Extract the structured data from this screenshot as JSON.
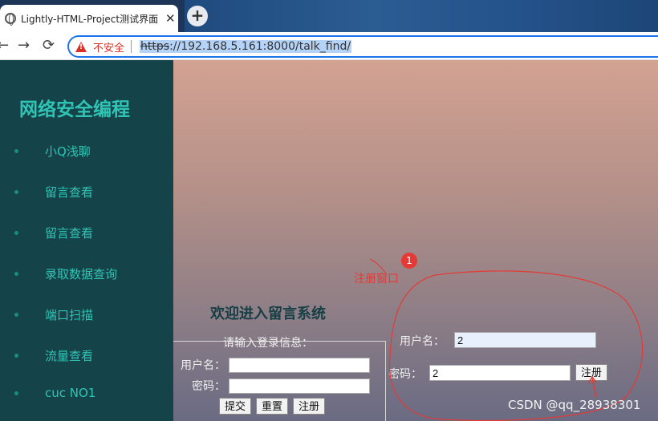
{
  "browser": {
    "tab_title": "Lightly-HTML-Project测试界面",
    "tab_close": "✕",
    "new_tab": "+",
    "back": "←",
    "forward": "→",
    "reload": "⟳",
    "security_label": "不安全",
    "url_scheme": "https",
    "url_rest": "://192.168.5.161:8000/talk_find/"
  },
  "sidebar": {
    "brand": "网络安全编程",
    "items": [
      {
        "label": "小Q浅聊"
      },
      {
        "label": "留言查看"
      },
      {
        "label": "留言查看"
      },
      {
        "label": "录取数据查询"
      },
      {
        "label": "端口扫描"
      },
      {
        "label": "流量查看"
      },
      {
        "label": "cuc NO1"
      }
    ]
  },
  "login": {
    "welcome": "欢迎进入留言系统",
    "legend": "请输入登录信息：",
    "username_label": "用户名：",
    "password_label": "密码：",
    "username_value": "",
    "password_value": "",
    "submit": "提交",
    "reset": "重置",
    "register": "注册"
  },
  "register": {
    "username_label": "用户名：",
    "username_value": "2",
    "password_label": "密码：",
    "password_value": "2",
    "register": "注册"
  },
  "annotations": {
    "badge": "1",
    "text": "注册窗口",
    "color": "#e53935"
  },
  "watermark": "CSDN @qq_28938301",
  "colors": {
    "sidebar_bg": "#14434a",
    "sidebar_text": "#2fc5b4",
    "accent": "#1a73e8",
    "insecure": "#d93025"
  }
}
